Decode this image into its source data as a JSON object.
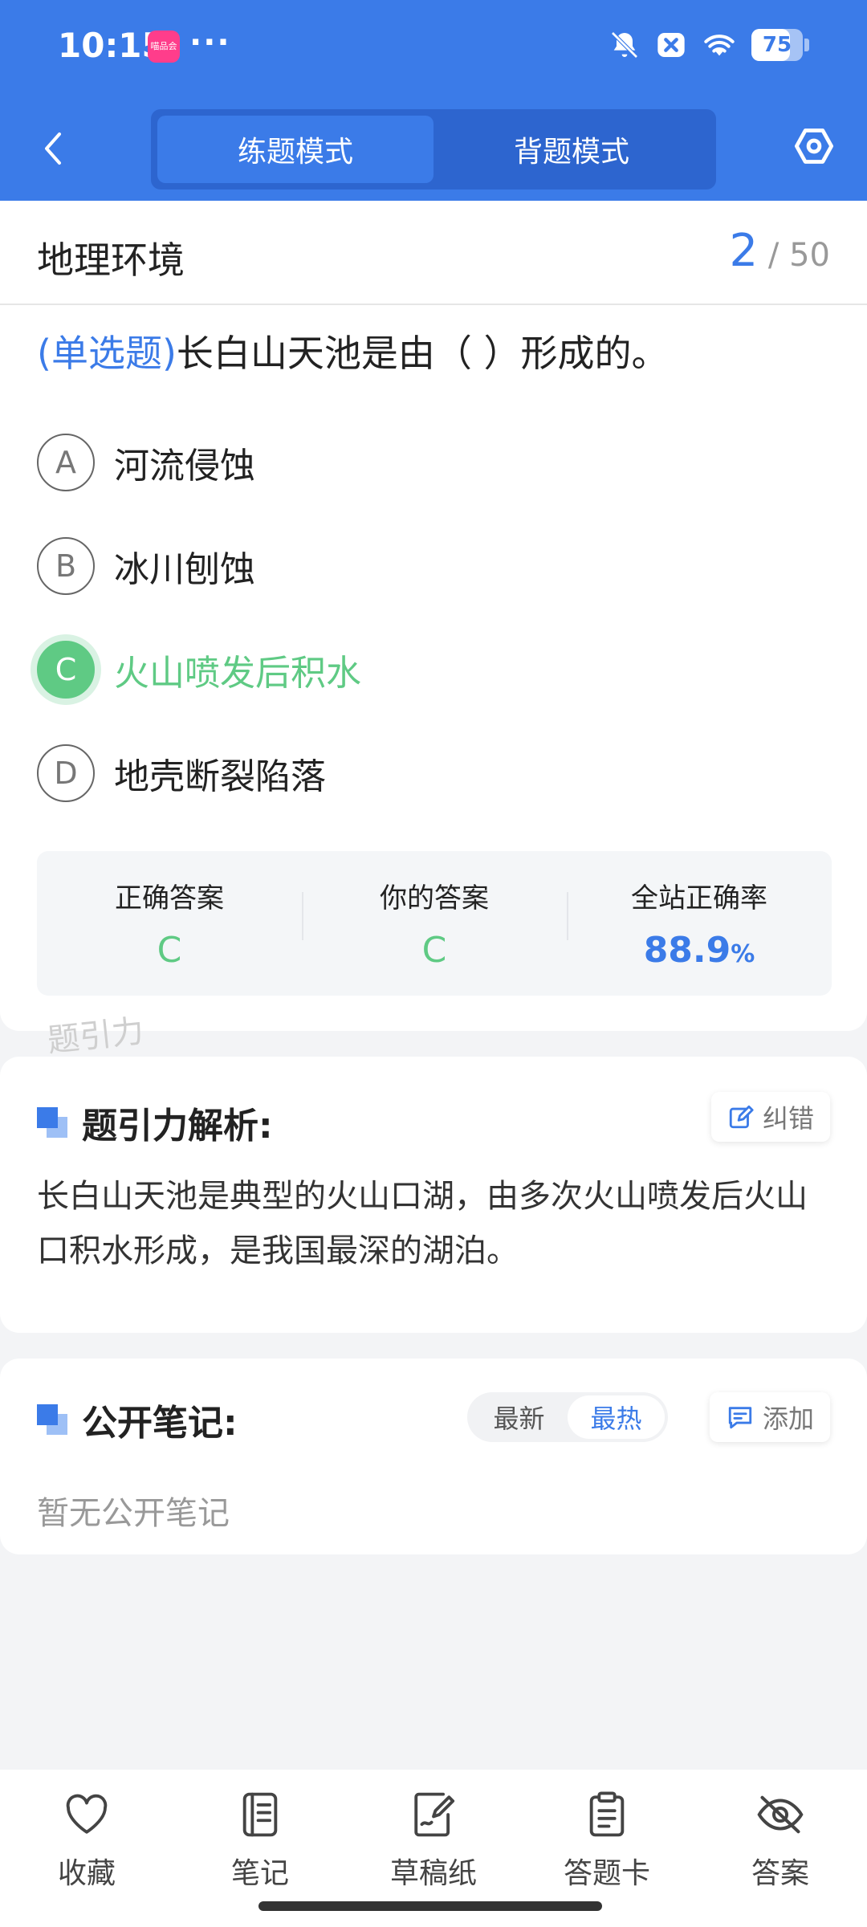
{
  "status_bar": {
    "time": "10:15",
    "app_badge": "喵品会",
    "dots": "···",
    "battery": "75",
    "battery_level": 0.75
  },
  "header": {
    "tabs": [
      {
        "label": "练题模式",
        "active": true
      },
      {
        "label": "背题模式",
        "active": false
      }
    ]
  },
  "question": {
    "section": "地理环境",
    "current": "2",
    "total": "/ 50",
    "type": "(单选题)",
    "text": "长白山天池是由（        ）形成的。",
    "options": [
      {
        "letter": "A",
        "text": "河流侵蚀"
      },
      {
        "letter": "B",
        "text": "冰川刨蚀"
      },
      {
        "letter": "C",
        "text": "火山喷发后积水"
      },
      {
        "letter": "D",
        "text": "地壳断裂陷落"
      }
    ],
    "correct_option": "C"
  },
  "stats": {
    "correct_label": "正确答案",
    "correct_value": "C",
    "yours_label": "你的答案",
    "yours_value": "C",
    "rate_label": "全站正确率",
    "rate_value": "88.9",
    "rate_unit": "%"
  },
  "watermark": "题引力",
  "analysis": {
    "title": "题引力解析:",
    "report_label": "纠错",
    "text": "长白山天池是典型的火山口湖，由多次火山喷发后火山口积水形成，是我国最深的湖泊。"
  },
  "notes": {
    "title": "公开笔记:",
    "sort_options": [
      {
        "label": "最新",
        "active": false
      },
      {
        "label": "最热",
        "active": true
      }
    ],
    "add_label": "添加",
    "empty": "暂无公开笔记"
  },
  "bottom_bar": {
    "items": [
      {
        "label": "收藏",
        "icon": "heart-icon"
      },
      {
        "label": "笔记",
        "icon": "notebook-icon"
      },
      {
        "label": "草稿纸",
        "icon": "draft-icon"
      },
      {
        "label": "答题卡",
        "icon": "clipboard-icon"
      },
      {
        "label": "答案",
        "icon": "eye-off-icon"
      }
    ]
  },
  "colors": {
    "primary": "#3b7be8",
    "correct": "#5fca84"
  }
}
